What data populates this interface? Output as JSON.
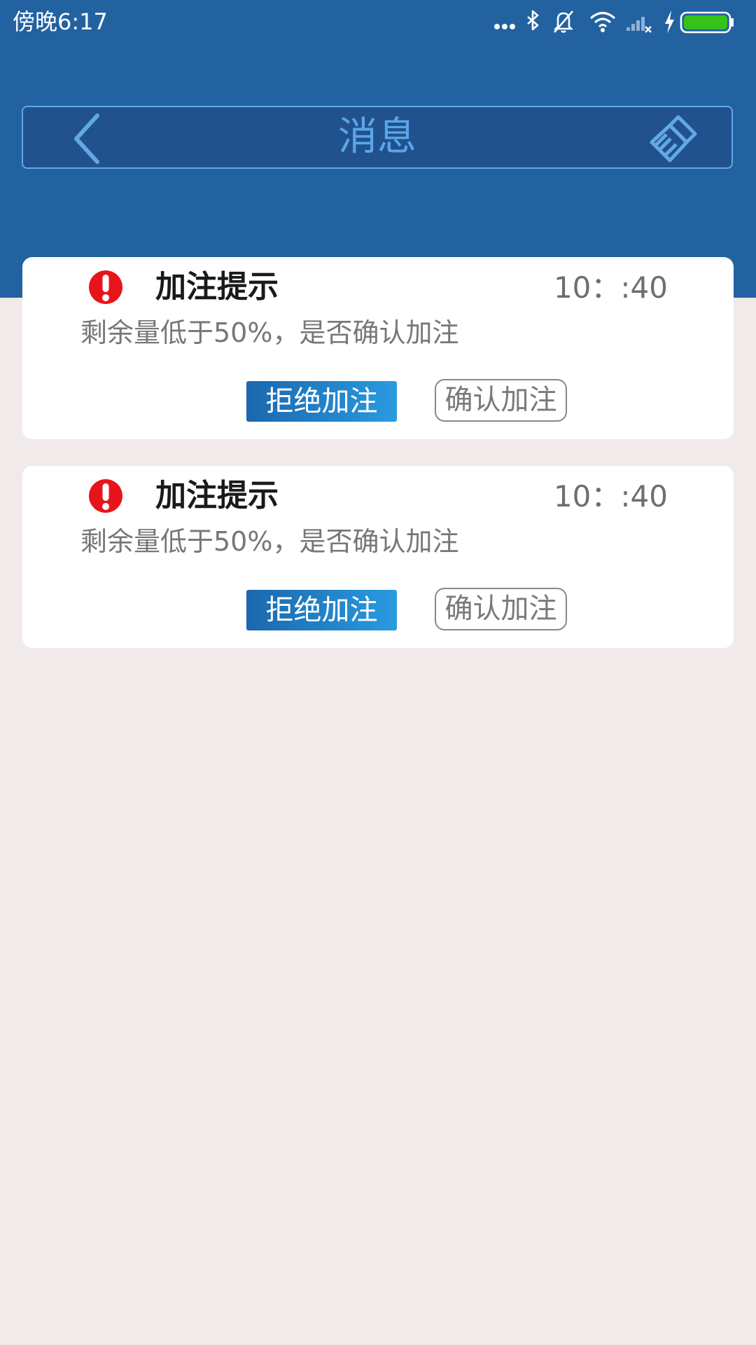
{
  "status_bar": {
    "time": "傍晚6:17",
    "icons": [
      "more-dots-icon",
      "bluetooth-icon",
      "mute-icon",
      "wifi-icon",
      "signal-icon",
      "charging-icon",
      "battery-icon"
    ],
    "battery_level": 1.0,
    "battery_color": "#35c21b"
  },
  "header": {
    "title": "消息",
    "back_icon": "chevron-left-icon",
    "clear_icon": "broom-icon",
    "background_color": "#2262a0",
    "accent_color": "#5aa6e8"
  },
  "messages": [
    {
      "icon": "alert-icon",
      "title": "加注提示",
      "time": "10：:40",
      "body": "剩余量低于50%，是否确认加注",
      "reject_label": "拒绝加注",
      "confirm_label": "确认加注"
    },
    {
      "icon": "alert-icon",
      "title": "加注提示",
      "time": "10：:40",
      "body": "剩余量低于50%，是否确认加注",
      "reject_label": "拒绝加注",
      "confirm_label": "确认加注"
    }
  ]
}
